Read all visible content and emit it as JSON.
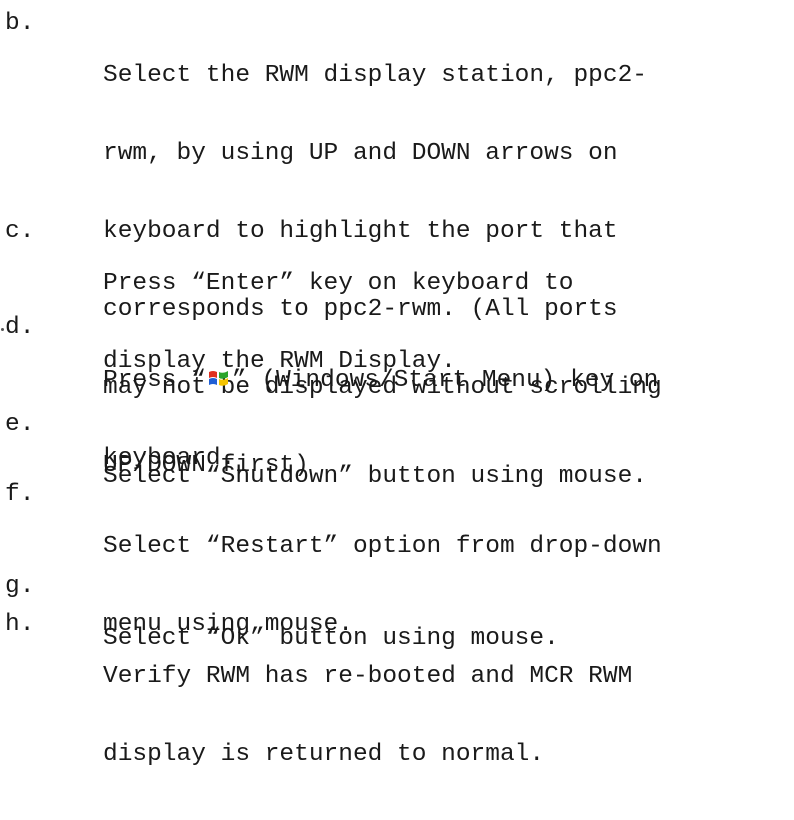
{
  "steps": [
    {
      "letter": "b.",
      "lines": [
        "Select the RWM display station, ppc2-",
        "rwm, by using UP and DOWN arrows on",
        "keyboard to highlight the port that",
        "corresponds to ppc2-rwm. (All ports",
        "may not be displayed without scrolling",
        "UP/DOWN first)"
      ]
    },
    {
      "letter": "c.",
      "lines": [
        "Press “Enter” key on keyboard to",
        "display the RWM Display."
      ]
    },
    {
      "letter": "d.",
      "line1_before_icon": "Press “",
      "line1_after_icon": "” (Windows/Start Menu) key on",
      "line2": "keyboard.",
      "icon": "windows-logo-icon"
    },
    {
      "letter": "e.",
      "lines": [
        "Select “Shutdown” button using mouse."
      ]
    },
    {
      "letter": "f.",
      "lines": [
        "Select “Restart” option from drop-down",
        "menu using mouse."
      ]
    },
    {
      "letter": "g.",
      "lines": [
        "Select “Ok” button using mouse."
      ]
    },
    {
      "letter": "h.",
      "lines": [
        "Verify RWM has re-booted and MCR RWM",
        "display is returned to normal."
      ]
    }
  ],
  "colors": {
    "text": "#1a1a1a",
    "background": "#ffffff",
    "windows_logo": [
      "#e0301e",
      "#2aa52a",
      "#1f5fd6",
      "#f5c400"
    ]
  }
}
